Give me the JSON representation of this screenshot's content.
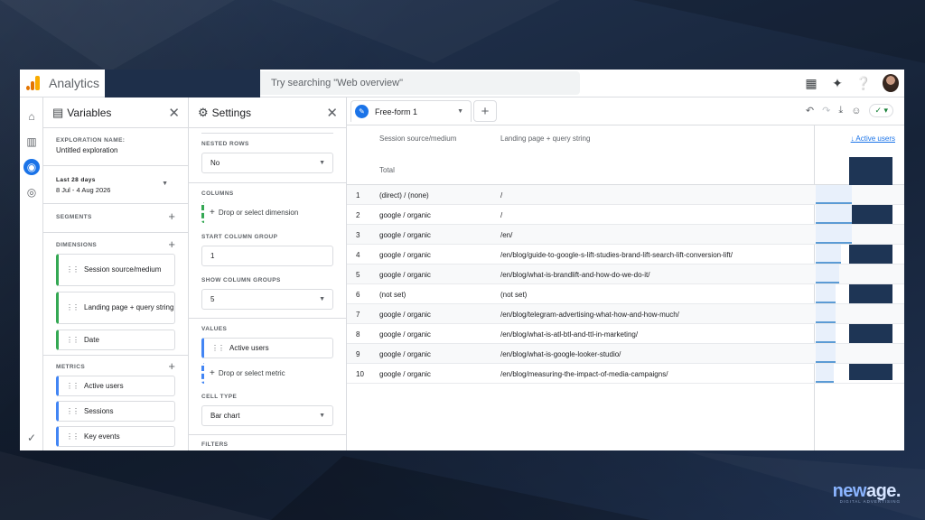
{
  "app": {
    "title": "Analytics",
    "search_placeholder": "Try searching \"Web overview\""
  },
  "variables": {
    "title": "Variables",
    "exploration_name_label": "EXPLORATION NAME:",
    "exploration_name": "Untitled exploration",
    "date_range_label": "Last 28 days",
    "date_range_value": "8 Jul - 4 Aug 2026",
    "segments_label": "SEGMENTS",
    "dimensions_label": "DIMENSIONS",
    "dimensions": [
      "Session source/medium",
      "Landing page + query string",
      "Date"
    ],
    "metrics_label": "METRICS",
    "metrics": [
      "Active users",
      "Sessions",
      "Key events"
    ]
  },
  "settings": {
    "title": "Settings",
    "nested_rows_label": "NESTED ROWS",
    "nested_rows_value": "No",
    "columns_label": "COLUMNS",
    "columns_drop": "Drop or select dimension",
    "start_col_group_label": "START COLUMN GROUP",
    "start_col_group_value": "1",
    "show_col_groups_label": "SHOW COLUMN GROUPS",
    "show_col_groups_value": "5",
    "values_label": "VALUES",
    "values_item": "Active users",
    "values_drop": "Drop or select metric",
    "cell_type_label": "CELL TYPE",
    "cell_type_value": "Bar chart",
    "filters_label": "FILTERS"
  },
  "report": {
    "tab_name": "Free-form 1",
    "col1": "Session source/medium",
    "col2": "Landing page + query string",
    "metric": "Active users",
    "total_label": "Total",
    "rows": [
      {
        "n": "1",
        "source": "(direct) / (none)",
        "page": "/",
        "level": 1.0
      },
      {
        "n": "2",
        "source": "google / organic",
        "page": "/",
        "level": 1.0
      },
      {
        "n": "3",
        "source": "google / organic",
        "page": "/en/",
        "level": 1.0
      },
      {
        "n": "4",
        "source": "google / organic",
        "page": "/en/blog/guide-to-google-s-lift-studies-brand-lift-search-lift-conversion-lift/",
        "level": 0.7
      },
      {
        "n": "5",
        "source": "google / organic",
        "page": "/en/blog/what-is-brandlift-and-how-do-we-do-it/",
        "level": 0.65
      },
      {
        "n": "6",
        "source": "(not set)",
        "page": "(not set)",
        "level": 0.55
      },
      {
        "n": "7",
        "source": "google / organic",
        "page": "/en/blog/telegram-advertising-what-how-and-how-much/",
        "level": 0.55
      },
      {
        "n": "8",
        "source": "google / organic",
        "page": "/en/blog/what-is-atl-btl-and-ttl-in-marketing/",
        "level": 0.55
      },
      {
        "n": "9",
        "source": "google / organic",
        "page": "/en/blog/what-is-google-looker-studio/",
        "level": 0.55
      },
      {
        "n": "10",
        "source": "google / organic",
        "page": "/en/blog/measuring-the-impact-of-media-campaigns/",
        "level": 0.5
      }
    ]
  },
  "brand": {
    "name_a": "new",
    "name_b": "age.",
    "tagline": "DIGITAL ADVERTISING"
  }
}
